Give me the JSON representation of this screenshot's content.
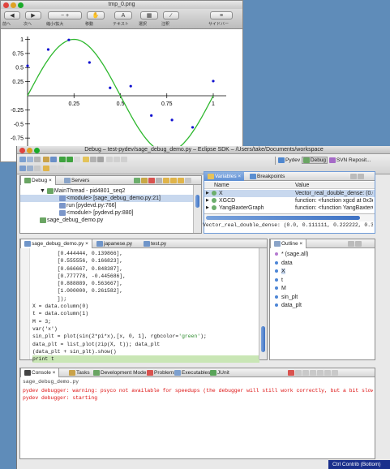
{
  "preview": {
    "title": "tmp_0.png",
    "toolbar": {
      "items": [
        {
          "icon": "◀",
          "label": "前へ"
        },
        {
          "icon": "▶",
          "label": "次へ"
        },
        {
          "icon": "−   +",
          "label": "縮小/拡大"
        },
        {
          "icon": "✋",
          "label": "移動"
        },
        {
          "icon": "A",
          "label": "テキスト"
        },
        {
          "icon": "▦",
          "label": "選択"
        },
        {
          "icon": "∕",
          "label": "注釈"
        },
        {
          "icon": "≡",
          "label": "サイドバー"
        }
      ]
    },
    "plot": {
      "chart_data": {
        "type": "line",
        "x_ticks": [
          "0.25",
          "0.5",
          "0.75",
          "1"
        ],
        "y_ticks": [
          "1",
          "0.75",
          "0.5",
          "0.25",
          "-0.25",
          "-0.5",
          "-0.75",
          "-1"
        ],
        "xlim": [
          0,
          1.02
        ],
        "ylim": [
          -1.05,
          1.05
        ],
        "series": [
          {
            "kind": "curve",
            "function": "sin(2*pi*x)",
            "color": "#2eb82e"
          },
          {
            "kind": "points",
            "color": "#1010d0",
            "x": [
              0.0,
              0.111111,
              0.222222,
              0.333333,
              0.444444,
              0.555556,
              0.666667,
              0.777778,
              0.888889,
              1.0
            ],
            "y": [
              0.53,
              0.82,
              0.99,
              0.59,
              0.14,
              0.17,
              -0.35,
              -0.43,
              -0.56,
              0.26
            ]
          }
        ]
      }
    }
  },
  "eclipse": {
    "title": "Debug – test-pydev/sage_debug_demo.py – Eclipse SDK – /Users/take/Documents/workspace",
    "perspectives": [
      "Pydev",
      "Debug",
      "SVN Reposit..."
    ],
    "debug_view": {
      "tabs": [
        "Debug",
        "Servers"
      ],
      "tree": [
        {
          "text": "MainThread - pid4801_seq2",
          "indent": 1
        },
        {
          "text": "<module> [sage_debug_demo.py:21]",
          "indent": 2,
          "selected": true
        },
        {
          "text": "run [pydevd.py:766]",
          "indent": 2
        },
        {
          "text": "<module> [pydevd.py:880]",
          "indent": 2
        },
        {
          "text": "sage_debug_demo.py",
          "indent": 1
        }
      ]
    },
    "variables_view": {
      "tabs": [
        "Variables",
        "Breakpoints"
      ],
      "columns": [
        "Name",
        "Value"
      ],
      "rows": [
        {
          "name": "X",
          "value": "Vector_real_double_dense: (0.0, 0.111...",
          "selected": true
        },
        {
          "name": "XGCD",
          "value": "function: <function xgcd at 0x3e3f..."
        },
        {
          "name": "YangBaxterGraph",
          "value": "function: <function YangBaxterGraph..."
        }
      ],
      "detail": "Vector_real_double_dense: (0.0, 0.111111, 0.222222, 0.333333"
    },
    "editor": {
      "tabs": [
        "sage_debug_demo.py",
        "japanese.py",
        "test.py"
      ],
      "lines": [
        "        [0.444444, 0.139866],",
        "        [0.555556, 0.166823],",
        "        [0.666667, 0.848387],",
        "        [0.777778, -0.445686],",
        "        [0.888889, 0.563667],",
        "        [1.000000, 0.261582],",
        "        ]);",
        "X = data.column(0)",
        "t = data.column(1)",
        "M = 3;",
        "var('x')",
        "sin_plt = plot(sin(2*pi*x),[x, 0, 1], rgbcolor='green');",
        "data_plt = list_plot(zip(X, t)); data_plt",
        "(data_plt + sin_plt).show()",
        "print t"
      ],
      "current_line": 14
    },
    "outline": {
      "tabs": [
        "Outline"
      ],
      "items": [
        "* (sage.all)",
        "data",
        "X",
        "t",
        "M",
        "sin_plt",
        "data_plt"
      ]
    },
    "console": {
      "tabs": [
        "Console",
        "Tasks",
        "Development Mode",
        "Problems",
        "Executables",
        "JUnit"
      ],
      "header": "sage_debug_demo.py",
      "lines": [
        "pydev debugger: warning: psyco not available for speedups (the debugger will still work correctly, but a bit slower)",
        "pydev debugger: starting"
      ]
    },
    "status": "Ctrl Contrib (Bottom)"
  }
}
